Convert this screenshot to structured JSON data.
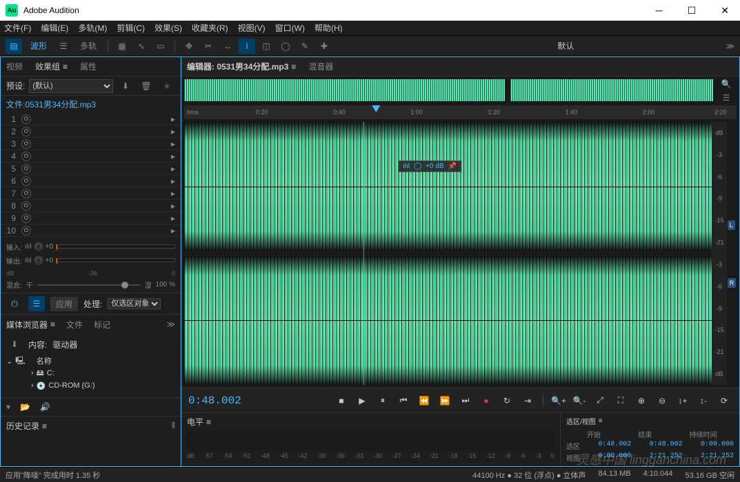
{
  "app": {
    "title": "Adobe Audition",
    "logo": "Au"
  },
  "menubar": [
    "文件(F)",
    "编辑(E)",
    "多轨(M)",
    "剪辑(C)",
    "效果(S)",
    "收藏夹(R)",
    "视图(V)",
    "窗口(W)",
    "帮助(H)"
  ],
  "toolbar": {
    "waveform": "波形",
    "multitrack": "多轨",
    "workspace": "默认"
  },
  "left": {
    "tabs": [
      "视频",
      "效果组",
      "属性"
    ],
    "active_tab": "效果组",
    "preset_label": "预设:",
    "preset_value": "(默认)",
    "file_label": "文件:",
    "file_name": "0531男34分配.mp3",
    "rack_slots": [
      1,
      2,
      3,
      4,
      5,
      6,
      7,
      8,
      9,
      10
    ],
    "input_label": "输入:",
    "output_label": "输出:",
    "io_gain": "+0",
    "db_marks": [
      "dB",
      "-36",
      "0"
    ],
    "mix": {
      "dry": "混合:",
      "dry_lbl": "干",
      "wet_lbl": "湿",
      "pct": "100 %"
    },
    "apply": {
      "apply_btn": "应用",
      "process_lbl": "处理:",
      "process_val": "仅选区对象"
    },
    "browser": {
      "tabs": [
        "媒体浏览器",
        "文件",
        "标记"
      ],
      "content_lbl": "内容:",
      "content_val": "驱动器",
      "name_col": "名称",
      "drives": [
        "C:",
        "CD-ROM (G:)"
      ]
    },
    "history": "历史记录"
  },
  "editor": {
    "tab_label": "编辑器: 0531男34分配.mp3",
    "mixer_tab": "混音器",
    "time_unit": "hms",
    "time_marks": [
      "0:20",
      "0:40",
      "1:00",
      "1:20",
      "1:40",
      "2:00",
      "2:20"
    ],
    "db_marks_top": [
      "dB",
      "-3",
      "-6",
      "-9",
      "-15",
      "-21"
    ],
    "db_marks_bot": [
      "",
      "-3",
      "-6",
      "-9",
      "-15",
      "-21",
      "dB"
    ],
    "chan_l": "L",
    "chan_r": "R",
    "hud_gain": "+0 dB",
    "timecode": "0:48.002"
  },
  "levels": {
    "title": "电平",
    "scale": [
      "dB",
      "-57",
      "-54",
      "-51",
      "-48",
      "-45",
      "-42",
      "-39",
      "-36",
      "-33",
      "-30",
      "-27",
      "-24",
      "-21",
      "-18",
      "-15",
      "-12",
      "-9",
      "-6",
      "-3",
      "0"
    ]
  },
  "selection": {
    "title": "选区/视图",
    "cols": [
      "开始",
      "结束",
      "持续时间"
    ],
    "rows": {
      "sel_lbl": "选区",
      "sel": [
        "0:48.002",
        "0:48.002",
        "0:00.000"
      ],
      "view_lbl": "视图",
      "view": [
        "0:00.000",
        "2:21.252",
        "2:21.252"
      ]
    }
  },
  "status": {
    "left": "应用\"降噪\" 完成用时 1.35 秒",
    "sample": "44100 Hz ● 32 位 (浮点) ● 立体声",
    "mem": "84.13 MB",
    "dur": "4:10.044",
    "disk": "53.16 GB 空闲"
  },
  "watermark": "灵感中国 lingganchina.com"
}
